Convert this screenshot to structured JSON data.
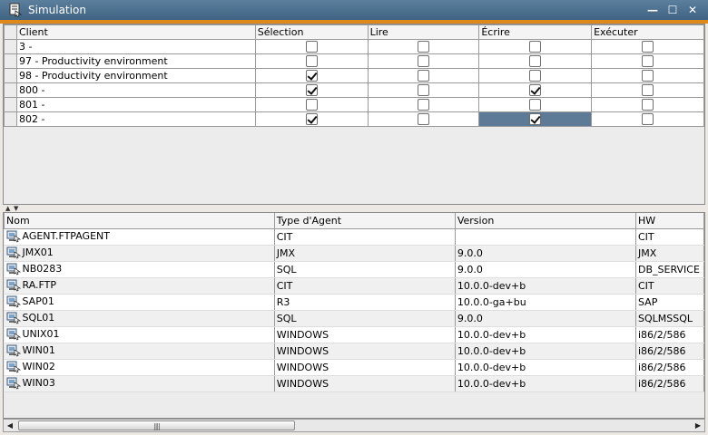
{
  "window": {
    "title": "Simulation",
    "controls": {
      "close": "✕",
      "maximize": "☐",
      "minimize": "—"
    }
  },
  "permissions": {
    "headers": [
      "Client",
      "Sélection",
      "Lire",
      "Écrire",
      "Exécuter"
    ],
    "rows": [
      {
        "client": "3 -",
        "selection": false,
        "lire": false,
        "ecrire": false,
        "executer": false
      },
      {
        "client": "97 - Productivity environment",
        "selection": false,
        "lire": false,
        "ecrire": false,
        "executer": false
      },
      {
        "client": "98 - Productivity environment",
        "selection": true,
        "lire": false,
        "ecrire": false,
        "executer": false
      },
      {
        "client": "800 -",
        "selection": true,
        "lire": false,
        "ecrire": true,
        "executer": false
      },
      {
        "client": "801 -",
        "selection": false,
        "lire": false,
        "ecrire": false,
        "executer": false
      },
      {
        "client": "802 -",
        "selection": true,
        "lire": false,
        "ecrire": true,
        "executer": false,
        "selected_cell": "ecrire"
      }
    ]
  },
  "agents": {
    "headers": [
      "Nom",
      "Type d'Agent",
      "Version",
      "HW"
    ],
    "rows": [
      {
        "nom": "AGENT.FTPAGENT",
        "type": "CIT",
        "version": "",
        "hw": "CIT"
      },
      {
        "nom": "JMX01",
        "type": "JMX",
        "version": "9.0.0",
        "hw": "JMX"
      },
      {
        "nom": "NB0283",
        "type": "SQL",
        "version": "9.0.0",
        "hw": "DB_SERVICE"
      },
      {
        "nom": "RA.FTP",
        "type": "CIT",
        "version": "10.0.0-dev+b",
        "hw": "CIT"
      },
      {
        "nom": "SAP01",
        "type": "R3",
        "version": "10.0.0-ga+bu",
        "hw": "SAP"
      },
      {
        "nom": "SQL01",
        "type": "SQL",
        "version": "9.0.0",
        "hw": "SQLMSSQL"
      },
      {
        "nom": "UNIX01",
        "type": "WINDOWS",
        "version": "10.0.0-dev+b",
        "hw": "i86/2/586"
      },
      {
        "nom": "WIN01",
        "type": "WINDOWS",
        "version": "10.0.0-dev+b",
        "hw": "i86/2/586"
      },
      {
        "nom": "WIN02",
        "type": "WINDOWS",
        "version": "10.0.0-dev+b",
        "hw": "i86/2/586"
      },
      {
        "nom": "WIN03",
        "type": "WINDOWS",
        "version": "10.0.0-dev+b",
        "hw": "i86/2/586"
      }
    ]
  },
  "scrollbar": {
    "left_arrow": "◀",
    "right_arrow": "▶",
    "grip": "||||"
  },
  "splitter": {
    "up_arrow": "▲",
    "down_arrow": "▼"
  },
  "colors": {
    "titlebar": "#4a6d8c",
    "accent_strip": "#e0891a",
    "selected_cell": "#5d7a96"
  }
}
